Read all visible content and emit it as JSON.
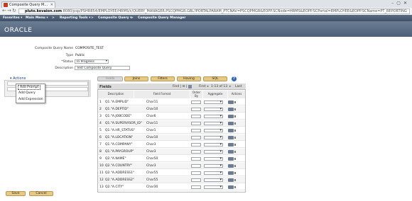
{
  "browser": {
    "tab_title": "Composite Query M...",
    "url_domain": "pluto.kovaion.com",
    "url_rest": ":8080/psp/PSHR854/EMPLOYEE/HRMS/c/QUERY_MANAGER.PSCQPMGR.GBL?PORTALPARAM_PTCNAV=PSCQPMGR&EOPP.SCNode=HRMS&EOPP.SCPortal=EMPLOYEE&EOPP.SCName=PT_REPORTING"
  },
  "menubar": {
    "favorites": "Favorites ▾",
    "main_menu": "Main Menu ▾",
    "bc1": "Reporting Tools ▾",
    "bc2": "Composite Query ▾",
    "bc3": "Composite Query Manager",
    "sep": ">"
  },
  "brand": {
    "logo": "ORACLE"
  },
  "form": {
    "name_label": "Composite Query Name",
    "name_value": "COMPOSITE_TEST",
    "type_label": "Type",
    "type_value": "Public",
    "status_label": "*Status",
    "status_value": "In Progress",
    "desc_label": "Description",
    "desc_value": "Test Composite Query"
  },
  "actions": {
    "header": "▾ Actions",
    "menu": [
      "Add Prompt",
      "Add Query",
      "Add Expression"
    ]
  },
  "tabs": [
    "Fields",
    "Joins",
    "Filters",
    "Having",
    "SQL"
  ],
  "help_icon": "?",
  "grid": {
    "title": "Fields",
    "find": "Find | ⊡ |",
    "first": "First",
    "range": "1-13 of 13",
    "last": "Last",
    "columns": [
      "Description",
      "Field Format",
      "Order By",
      "Aggregate",
      "Actions"
    ],
    "rows": [
      {
        "n": "1",
        "d": "Q1.\"A.EMPLID\"",
        "f": "Char11"
      },
      {
        "n": "2",
        "d": "Q1.\"A.DEPTID\"",
        "f": "Char10"
      },
      {
        "n": "3",
        "d": "Q1.\"A.JOBCODE\"",
        "f": "Char6"
      },
      {
        "n": "4",
        "d": "Q1.\"A.SUPERVISOR_ID\"",
        "f": "Char11"
      },
      {
        "n": "5",
        "d": "Q1.\"A.HR_STATUS\"",
        "f": "Char1"
      },
      {
        "n": "6",
        "d": "Q1.\"A.LOCATION\"",
        "f": "Char10"
      },
      {
        "n": "7",
        "d": "Q1.\"A.COMPANY\"",
        "f": "Char3"
      },
      {
        "n": "8",
        "d": "Q1.\"A.PAYGROUP\"",
        "f": "Char3"
      },
      {
        "n": "9",
        "d": "Q2.\"A.NAME\"",
        "f": "Char50"
      },
      {
        "n": "10",
        "d": "Q2.\"A.COUNTRY\"",
        "f": "Char3"
      },
      {
        "n": "11",
        "d": "Q2.\"A.ADDRESS1\"",
        "f": "Char55"
      },
      {
        "n": "12",
        "d": "Q2.\"A.ADDRESS2\"",
        "f": "Char55"
      },
      {
        "n": "13",
        "d": "Q2.\"A.CITY\"",
        "f": "Char30"
      }
    ]
  },
  "buttons": {
    "save": "Save",
    "cancel": "Cancel"
  }
}
